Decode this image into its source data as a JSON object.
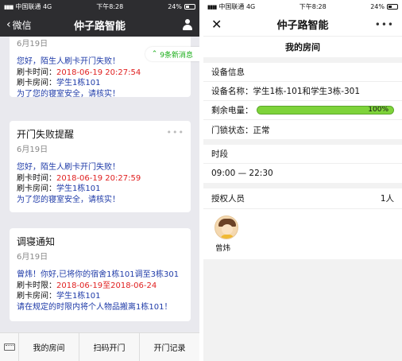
{
  "left": {
    "status": {
      "carrier": "中国联通 4G",
      "time": "下午8:28",
      "battery": "24%"
    },
    "nav": {
      "back_label": "微信",
      "title": "仲子路智能"
    },
    "new_messages": "9条新消息",
    "cards": [
      {
        "date": "6月19日",
        "lines": [
          {
            "text": "您好，陌生人刷卡开门失败！"
          },
          {
            "key": "刷卡时间：",
            "value": "2018-06-19 20:27:54",
            "red": true
          },
          {
            "key": "刷卡房间：",
            "value": "学生1栋101",
            "red": false
          },
          {
            "text": "为了您的寝室安全，请核实！"
          }
        ]
      },
      {
        "title": "开门失败提醒",
        "date": "6月19日",
        "lines": [
          {
            "text": "您好，陌生人刷卡开门失败！"
          },
          {
            "key": "刷卡时间：",
            "value": "2018-06-19 20:27:59",
            "red": true
          },
          {
            "key": "刷卡房间：",
            "value": "学生1栋101",
            "red": false
          },
          {
            "text": "为了您的寝室安全，请核实！"
          }
        ]
      },
      {
        "title": "调寝通知",
        "date": "6月19日",
        "lines": [
          {
            "text": "曾炜！你好,已将你的宿舍1栋101调至3栋301"
          },
          {
            "key": "刷卡时限：",
            "value": "2018-06-19至2018-06-24",
            "red": true
          },
          {
            "key": "刷卡房间：",
            "value": "学生1栋101",
            "red": false
          },
          {
            "text": "请在规定的时限内将个人物品搬离1栋101！"
          }
        ]
      }
    ],
    "tabs": [
      "我的房间",
      "扫码开门",
      "开门记录"
    ]
  },
  "right": {
    "status": {
      "carrier": "中国联通 4G",
      "time": "下午8:28",
      "battery": "24%"
    },
    "nav": {
      "close": "✕",
      "title": "仲子路智能",
      "more": "•••"
    },
    "page_title": "我的房间",
    "device_info": {
      "heading": "设备信息",
      "name_label": "设备名称：",
      "name_value": "学生1栋-101和学生3栋-301",
      "power_label": "剩余电量：",
      "power_percent": 100,
      "power_text": "100%",
      "lock_label": "门锁状态：",
      "lock_value": "正常"
    },
    "period": {
      "heading": "时段",
      "value": "09:00 — 22:30"
    },
    "auth": {
      "heading": "授权人员",
      "count": "1人",
      "person_name": "曾炜"
    }
  }
}
